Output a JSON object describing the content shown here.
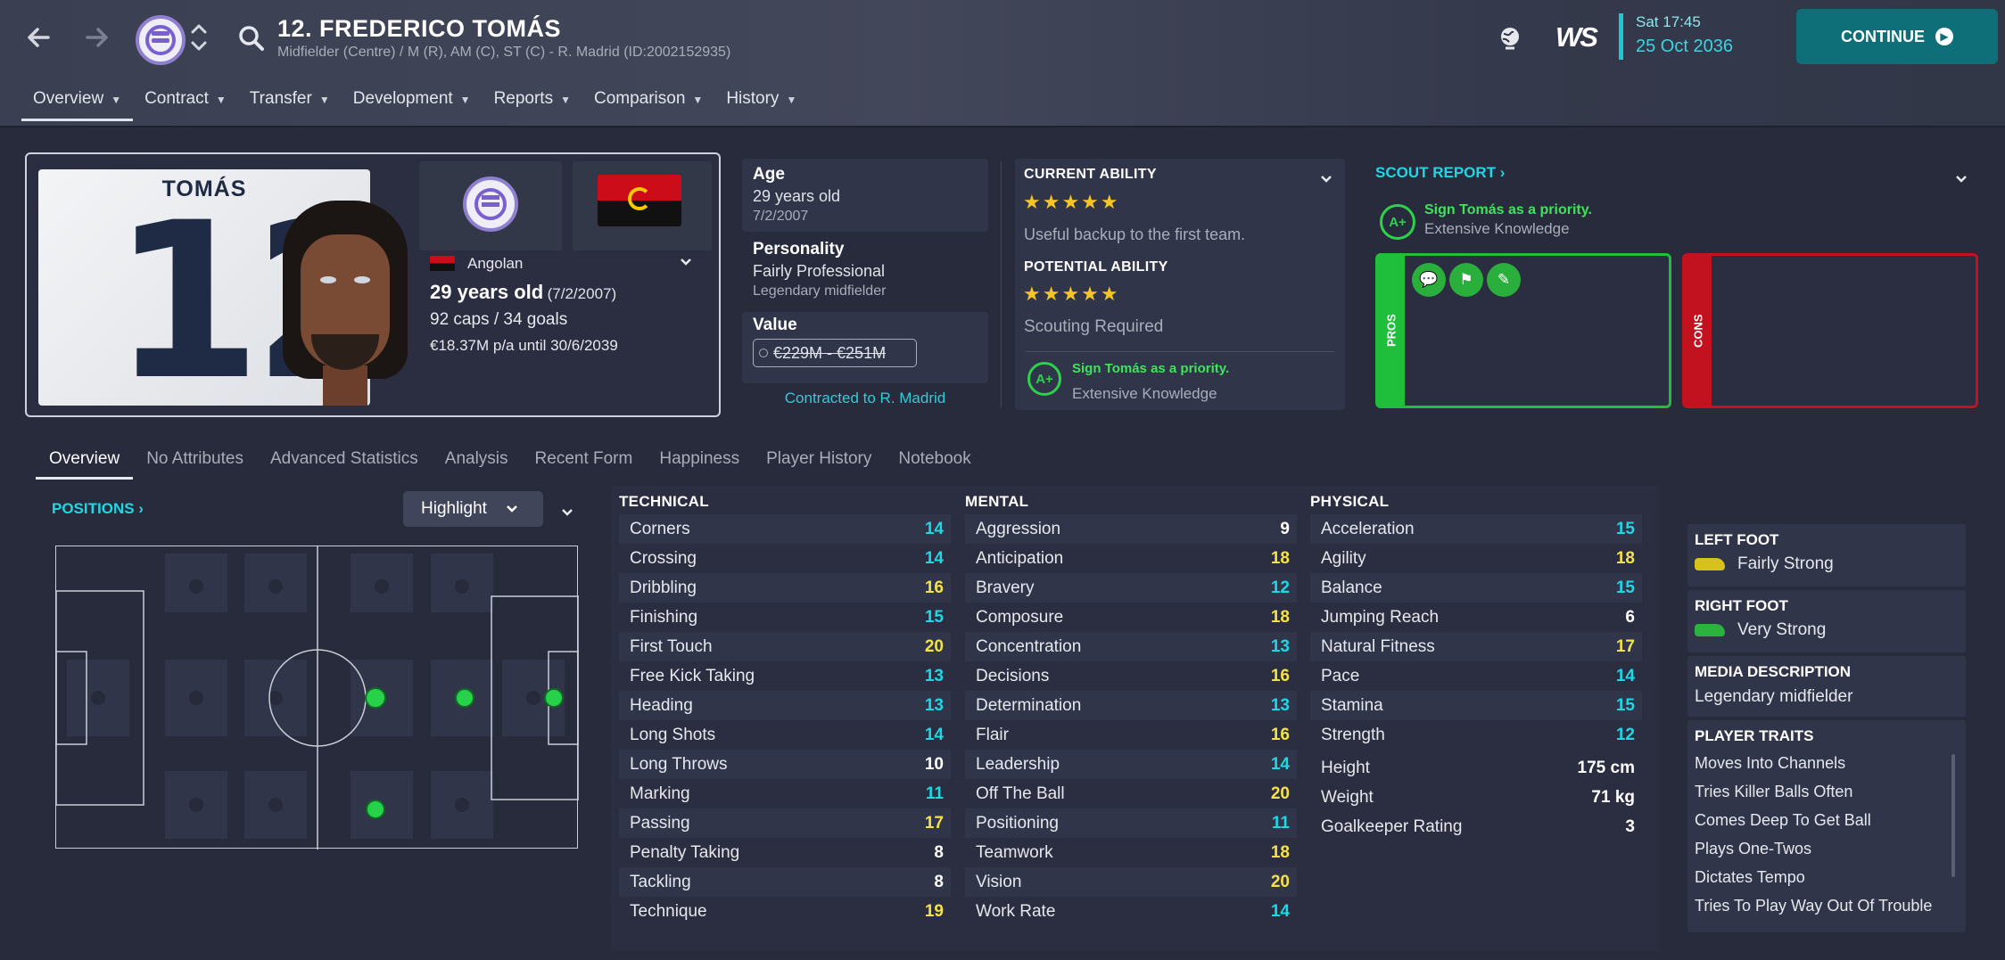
{
  "header": {
    "player_title": "12. FREDERICO TOMÁS",
    "player_subtitle": "Midfielder (Centre) / M (R), AM (C), ST (C) - R. Madrid (ID:2002152935)",
    "tabs": [
      {
        "label": "Overview"
      },
      {
        "label": "Contract"
      },
      {
        "label": "Transfer"
      },
      {
        "label": "Development"
      },
      {
        "label": "Reports"
      },
      {
        "label": "Comparison"
      },
      {
        "label": "History"
      }
    ],
    "time": "Sat 17:45",
    "date": "25 Oct 2036",
    "continue_label": "CONTINUE",
    "brand_logo": "WS"
  },
  "profile": {
    "shirt_name": "TOMÁS",
    "shirt_number": "12",
    "nationality": "Angolan",
    "age_line": "29 years old",
    "dob_paren": "(7/2/2007)",
    "caps_goals": "92 caps / 34 goals",
    "wage_contract": "€18.37M p/a until 30/6/2039"
  },
  "details": {
    "age_label": "Age",
    "age_value": "29 years old",
    "dob": "7/2/2007",
    "personality_label": "Personality",
    "personality_value": "Fairly Professional",
    "role_desc": "Legendary midfielder",
    "value_label": "Value",
    "value_range": "€229M - €251M",
    "contract_link": "Contracted to R. Madrid"
  },
  "ability": {
    "current_label": "CURRENT ABILITY",
    "current_stars": "★★★★★",
    "current_desc": "Useful backup to the first team.",
    "potential_label": "POTENTIAL ABILITY",
    "potential_stars": "★★★★★",
    "potential_desc": "Scouting Required",
    "grade": "A+",
    "recommendation": "Sign Tomás as a priority.",
    "knowledge": "Extensive Knowledge"
  },
  "scout": {
    "title": "SCOUT REPORT",
    "grade": "A+",
    "recommendation": "Sign Tomás as a priority.",
    "knowledge": "Extensive Knowledge",
    "pros_label": "PROS",
    "cons_label": "CONS"
  },
  "subtabs": [
    {
      "label": "Overview"
    },
    {
      "label": "No Attributes"
    },
    {
      "label": "Advanced Statistics"
    },
    {
      "label": "Analysis"
    },
    {
      "label": "Recent Form"
    },
    {
      "label": "Happiness"
    },
    {
      "label": "Player History"
    },
    {
      "label": "Notebook"
    }
  ],
  "positions": {
    "title": "POSITIONS",
    "highlight_label": "Highlight"
  },
  "technical": {
    "title": "TECHNICAL",
    "rows": [
      {
        "name": "Corners",
        "value": "14"
      },
      {
        "name": "Crossing",
        "value": "14"
      },
      {
        "name": "Dribbling",
        "value": "16"
      },
      {
        "name": "Finishing",
        "value": "15"
      },
      {
        "name": "First Touch",
        "value": "20"
      },
      {
        "name": "Free Kick Taking",
        "value": "13"
      },
      {
        "name": "Heading",
        "value": "13"
      },
      {
        "name": "Long Shots",
        "value": "14"
      },
      {
        "name": "Long Throws",
        "value": "10"
      },
      {
        "name": "Marking",
        "value": "11"
      },
      {
        "name": "Passing",
        "value": "17"
      },
      {
        "name": "Penalty Taking",
        "value": "8"
      },
      {
        "name": "Tackling",
        "value": "8"
      },
      {
        "name": "Technique",
        "value": "19"
      }
    ]
  },
  "mental": {
    "title": "MENTAL",
    "rows": [
      {
        "name": "Aggression",
        "value": "9"
      },
      {
        "name": "Anticipation",
        "value": "18"
      },
      {
        "name": "Bravery",
        "value": "12"
      },
      {
        "name": "Composure",
        "value": "18"
      },
      {
        "name": "Concentration",
        "value": "13"
      },
      {
        "name": "Decisions",
        "value": "16"
      },
      {
        "name": "Determination",
        "value": "13"
      },
      {
        "name": "Flair",
        "value": "16"
      },
      {
        "name": "Leadership",
        "value": "14"
      },
      {
        "name": "Off The Ball",
        "value": "20"
      },
      {
        "name": "Positioning",
        "value": "11"
      },
      {
        "name": "Teamwork",
        "value": "18"
      },
      {
        "name": "Vision",
        "value": "20"
      },
      {
        "name": "Work Rate",
        "value": "14"
      }
    ]
  },
  "physical": {
    "title": "PHYSICAL",
    "rows": [
      {
        "name": "Acceleration",
        "value": "15"
      },
      {
        "name": "Agility",
        "value": "18"
      },
      {
        "name": "Balance",
        "value": "15"
      },
      {
        "name": "Jumping Reach",
        "value": "6"
      },
      {
        "name": "Natural Fitness",
        "value": "17"
      },
      {
        "name": "Pace",
        "value": "14"
      },
      {
        "name": "Stamina",
        "value": "15"
      },
      {
        "name": "Strength",
        "value": "12"
      }
    ],
    "extra": [
      {
        "name": "Height",
        "value": "175 cm"
      },
      {
        "name": "Weight",
        "value": "71 kg"
      },
      {
        "name": "Goalkeeper Rating",
        "value": "3"
      }
    ]
  },
  "feet": {
    "left_label": "LEFT FOOT",
    "left_value": "Fairly Strong",
    "right_label": "RIGHT FOOT",
    "right_value": "Very Strong"
  },
  "media": {
    "label": "MEDIA DESCRIPTION",
    "value": "Legendary midfielder"
  },
  "traits": {
    "label": "PLAYER TRAITS",
    "items": [
      "Moves Into Channels",
      "Tries Killer Balls Often",
      "Comes Deep To Get Ball",
      "Plays One-Twos",
      "Dictates Tempo",
      "Tries To Play Way Out Of Trouble"
    ]
  },
  "colors": {
    "accent": "#1fd7e5",
    "attr_high": "#f5e24a",
    "attr_mid": "#1fd7e5",
    "pros": "#1fbf3c",
    "cons": "#c3121f",
    "continue": "#0f6f79"
  }
}
